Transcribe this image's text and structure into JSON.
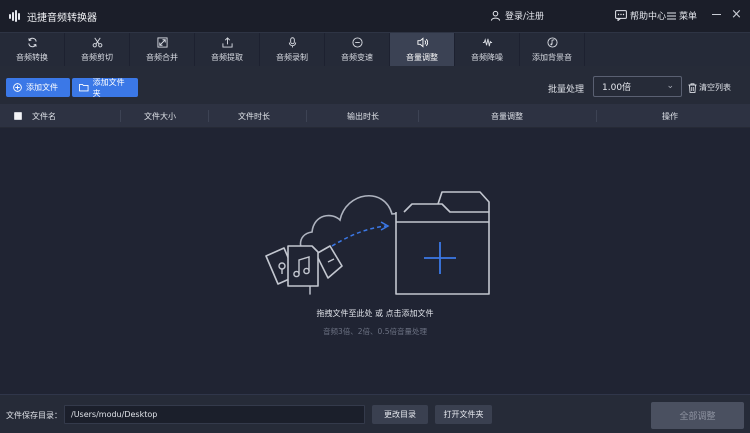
{
  "app": {
    "title": "迅捷音频转换器"
  },
  "header": {
    "login_label": "登录/注册",
    "help_label": "帮助中心",
    "menu_label": "菜单"
  },
  "tabs": [
    {
      "label": "音频转换",
      "icon": "refresh-icon"
    },
    {
      "label": "音频剪切",
      "icon": "scissors-icon"
    },
    {
      "label": "音频合并",
      "icon": "merge-icon"
    },
    {
      "label": "音频提取",
      "icon": "extract-icon"
    },
    {
      "label": "音频录制",
      "icon": "microphone-icon"
    },
    {
      "label": "音频变速",
      "icon": "speed-icon"
    },
    {
      "label": "音量调整",
      "icon": "volume-icon",
      "active": true
    },
    {
      "label": "音频降噪",
      "icon": "noise-reduction-icon"
    },
    {
      "label": "添加背景音",
      "icon": "music-icon"
    }
  ],
  "toolbar": {
    "add_file_label": "添加文件",
    "add_folder_label": "添加文件夹",
    "batch_label": "批量处理",
    "batch_value": "1.00倍",
    "clear_label": "清空列表"
  },
  "table": {
    "columns": [
      "文件名",
      "文件大小",
      "文件时长",
      "输出时长",
      "音量调整",
      "操作"
    ]
  },
  "empty_state": {
    "hint": "拖拽文件至此处 或 点击添加文件",
    "sub_hint": "音频3倍、2倍、0.5倍音量处理"
  },
  "footer": {
    "save_dir_label": "文件保存目录：",
    "save_dir_value": "/Users/modu/Desktop",
    "change_dir_label": "更改目录",
    "open_folder_label": "打开文件夹",
    "convert_all_label": "全部调整"
  },
  "colors": {
    "accent": "#3b78e7",
    "background": "#1f2330",
    "active_tab": "#3b4254"
  }
}
